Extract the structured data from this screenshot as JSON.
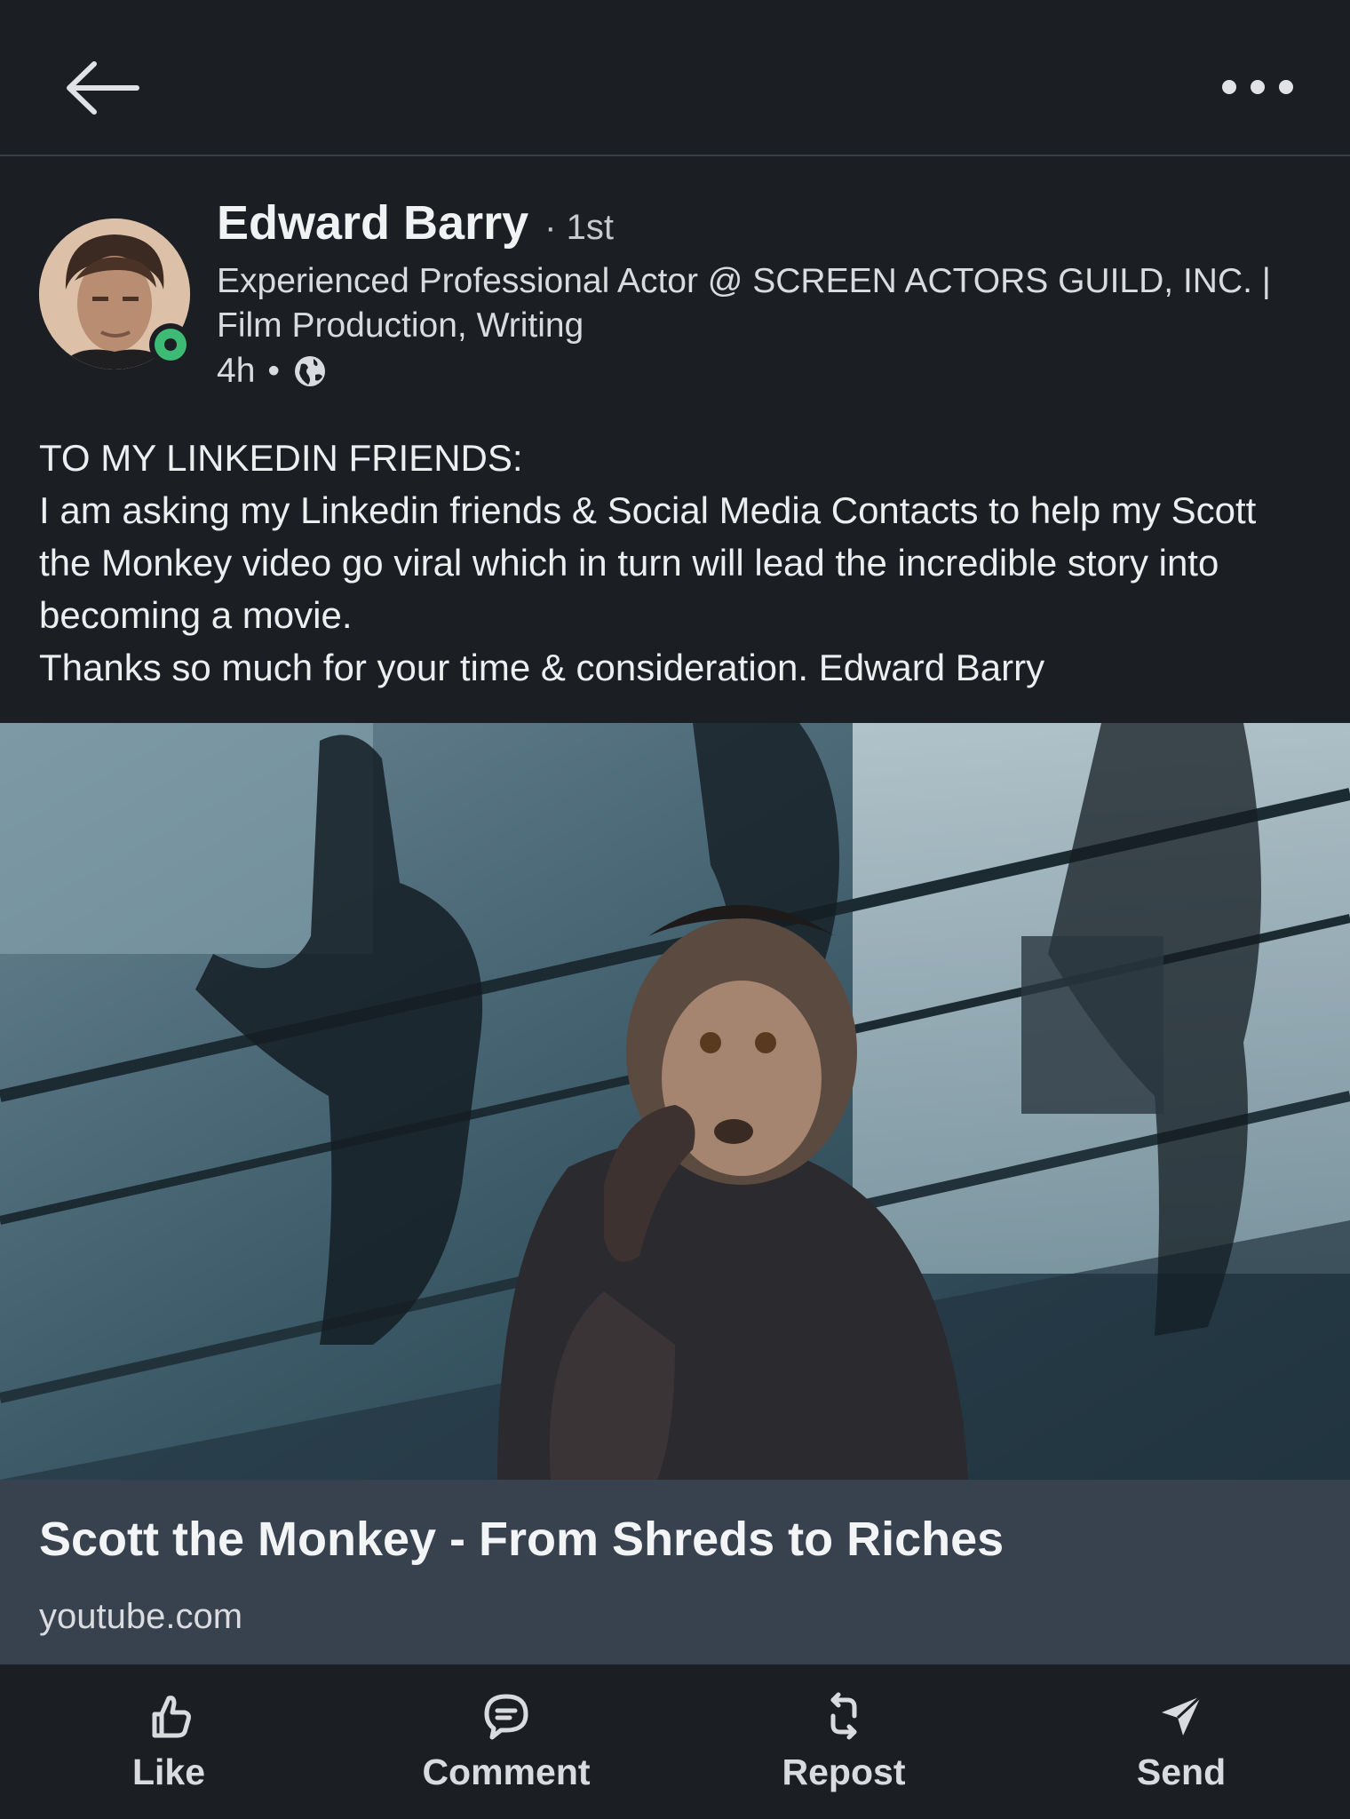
{
  "header": {
    "back_icon": "arrow-left-icon",
    "more_icon": "ellipsis-icon"
  },
  "post": {
    "author": {
      "name": "Edward Barry",
      "degree": "· 1st",
      "headline": "Experienced Professional Actor @ SCREEN ACTORS GUILD, INC. | Film Production, Writing",
      "time": "4h",
      "separator": "•",
      "visibility_icon": "globe-icon",
      "presence_color": "#3dbb74"
    },
    "text": [
      "TO MY LINKEDIN FRIENDS:",
      "I am asking my Linkedin friends & Social Media Contacts to help my Scott the Monkey video go viral which in turn will lead the incredible story into becoming a movie.",
      "Thanks so much for your time & consideration. Edward Barry"
    ],
    "link_preview": {
      "title": "Scott the Monkey - From Shreds to Riches",
      "domain": "youtube.com"
    }
  },
  "actions": {
    "like": "Like",
    "comment": "Comment",
    "repost": "Repost",
    "send": "Send"
  }
}
